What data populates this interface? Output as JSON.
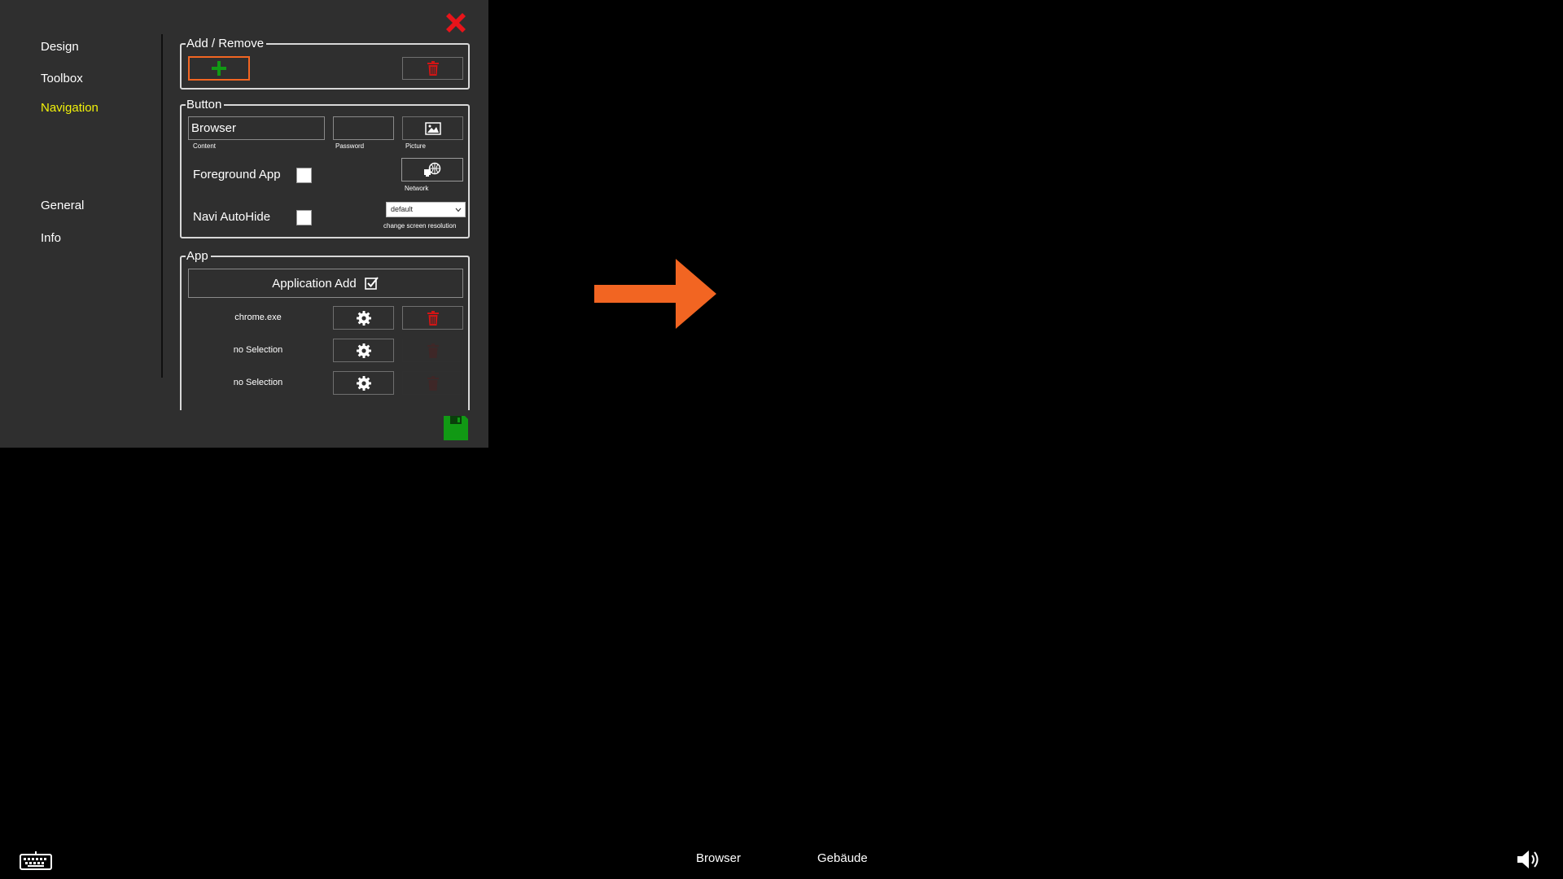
{
  "nav": {
    "items": [
      {
        "label": "Design",
        "active": false
      },
      {
        "label": "Toolbox",
        "active": false
      },
      {
        "label": "Navigation",
        "active": true
      },
      {
        "label": "General",
        "active": false
      },
      {
        "label": "Info",
        "active": false
      }
    ]
  },
  "add_remove": {
    "legend": "Add / Remove",
    "add_icon": "plus-icon",
    "remove_icon": "trash-icon"
  },
  "button_group": {
    "legend": "Button",
    "content_value": "Browser",
    "content_label": "Content",
    "password_value": "",
    "password_label": "Password",
    "picture_label": "Picture",
    "network_label": "Network",
    "foreground_app_label": "Foreground App",
    "foreground_app_checked": false,
    "navi_autohide_label": "Navi AutoHide",
    "navi_autohide_checked": false,
    "resolution_selected": "default",
    "resolution_label": "change screen resolution"
  },
  "app_group": {
    "legend": "App",
    "add_label": "Application Add",
    "apps": [
      {
        "name": "chrome.exe",
        "delete_enabled": true
      },
      {
        "name": "no Selection",
        "delete_enabled": false
      },
      {
        "name": "no Selection",
        "delete_enabled": false
      }
    ]
  },
  "taskbar": {
    "items": [
      "Browser",
      "Gebäude"
    ],
    "keyboard_icon": "keyboard-icon",
    "volume_icon": "volume-icon"
  },
  "colors": {
    "dialog_bg": "#2f2f2f",
    "active_nav": "#f2f20a",
    "close": "#e8141a",
    "add": "#119914",
    "delete": "#d01515",
    "save": "#119914",
    "highlight_arrow": "#f26522"
  }
}
